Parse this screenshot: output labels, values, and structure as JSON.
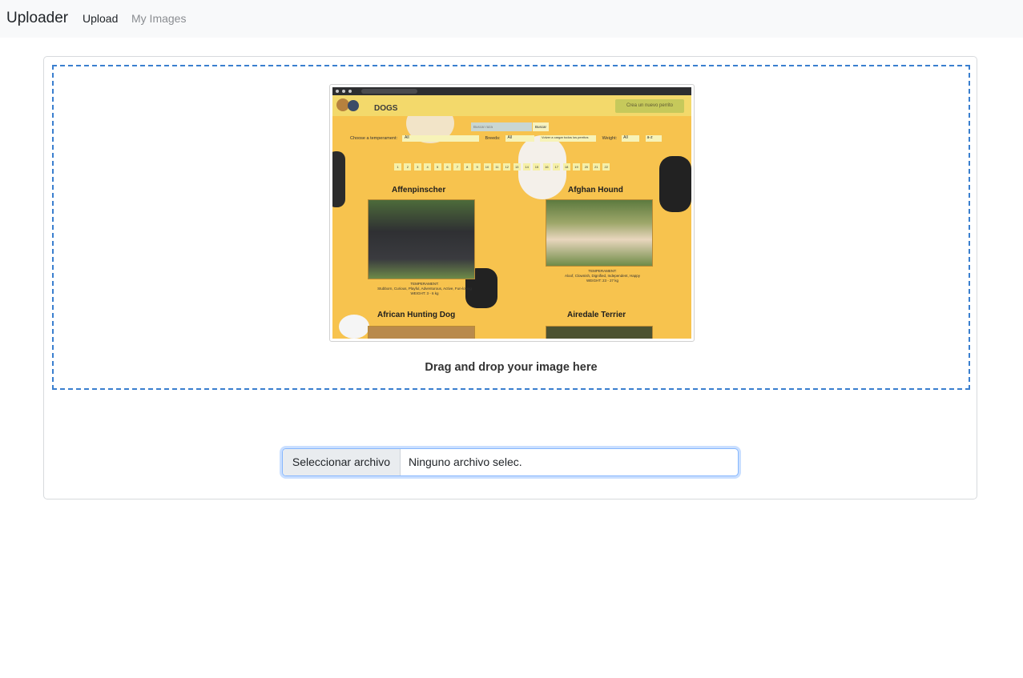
{
  "navbar": {
    "brand": "Uploader",
    "links": [
      {
        "label": "Upload",
        "active": true
      },
      {
        "label": "My Images",
        "active": false
      }
    ]
  },
  "dropzone": {
    "text": "Drag and drop your image here",
    "border_color": "#3a7fcf"
  },
  "preview": {
    "site_title": "DOGS",
    "create_button": "Crea un nuevo perrito",
    "search_placeholder": "Buscar raza",
    "search_button": "Buscar",
    "filters": {
      "temperament_label": "Choose a temperament:",
      "temperament_value": "All",
      "breeds_label": "Breeds:",
      "breeds_value": "All",
      "reload_button": "Volver a cargar todos los perritos",
      "weight_label": "Weight:",
      "weight_value": "All",
      "sort_value": "a-z"
    },
    "pages": [
      "1",
      "2",
      "3",
      "4",
      "5",
      "6",
      "7",
      "8",
      "9",
      "10",
      "11",
      "12",
      "13",
      "14",
      "15",
      "16",
      "17",
      "18",
      "19",
      "20",
      "21",
      "22"
    ],
    "dogs": [
      {
        "name": "Affenpinscher",
        "temperament_label": "TEMPERAMENT:",
        "temperament": "Stubborn, Curious, Playful, Adventurous, Active, Fun-loving",
        "weight": "WEIGHT: 3 - 6 kg"
      },
      {
        "name": "Afghan Hound",
        "temperament_label": "TEMPERAMENT:",
        "temperament": "Aloof, Clownish, Dignified, Independent, Happy",
        "weight": "WEIGHT: 23 - 27 kg"
      },
      {
        "name": "African Hunting Dog"
      },
      {
        "name": "Airedale Terrier"
      }
    ]
  },
  "file_input": {
    "button_label": "Seleccionar archivo",
    "status_text": "Ninguno archivo selec."
  },
  "colors": {
    "navbar_bg": "#f8f9fa",
    "accent_blue": "#3a7fcf",
    "preview_bg": "#f7c34e"
  }
}
